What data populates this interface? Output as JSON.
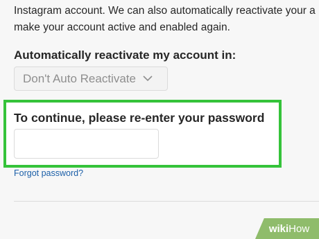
{
  "intro": {
    "line1": "Instagram account. We can also automatically reactivate your a",
    "line2": "make your account active and enabled again."
  },
  "reactivate": {
    "label": "Automatically reactivate my account in:",
    "selected_value": "Don't Auto Reactivate",
    "chevron_icon": "chevron-down-icon"
  },
  "password": {
    "label": "To continue, please re-enter your password",
    "value": "",
    "placeholder": "",
    "forgot_label": "Forgot password?"
  },
  "highlight_color": "#35c33a",
  "link_color": "#1b5fa8",
  "watermark": {
    "wiki": "wiki",
    "how": "How"
  }
}
